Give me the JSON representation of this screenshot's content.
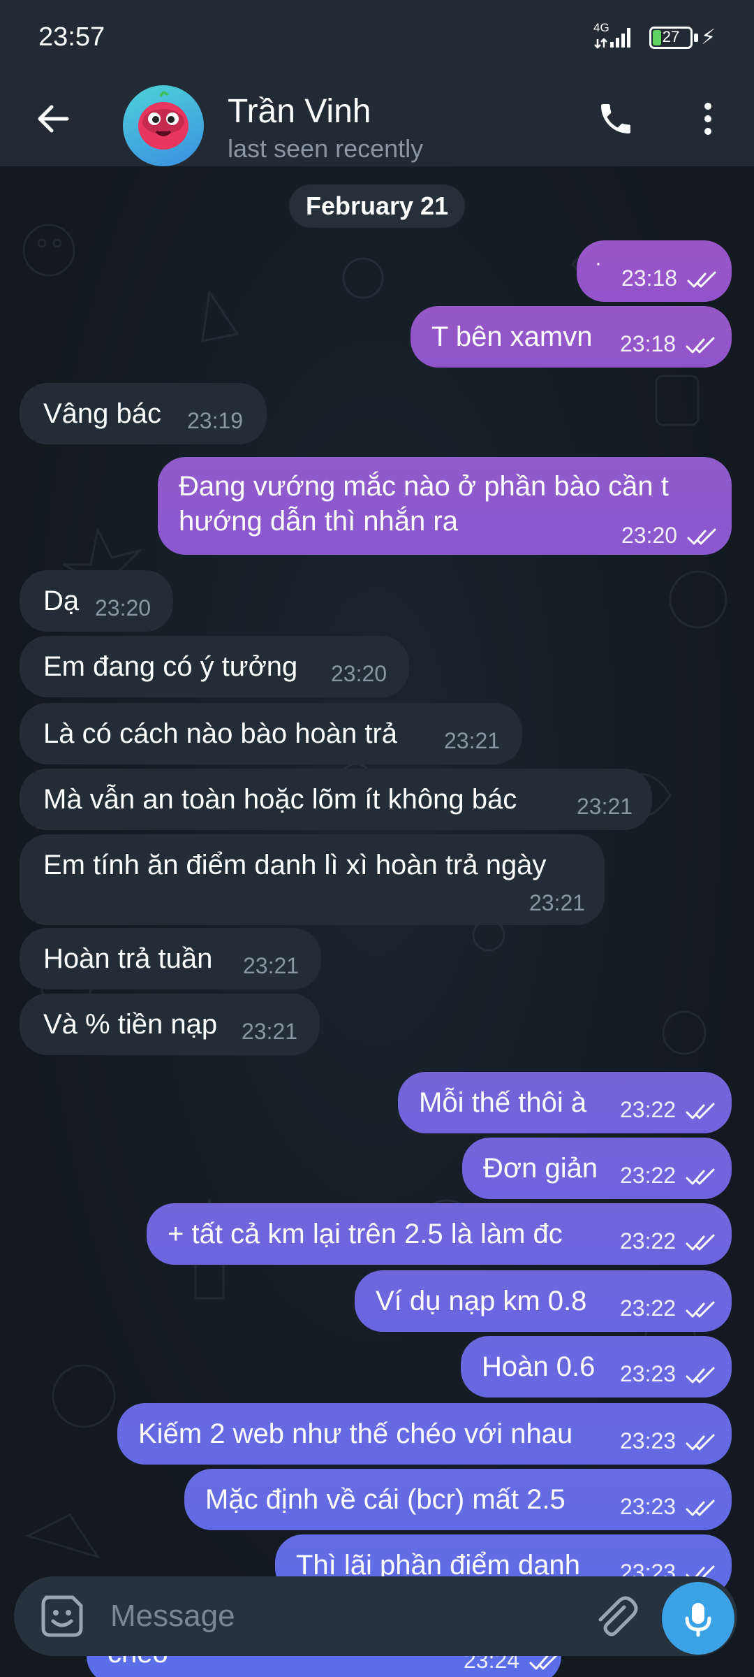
{
  "status_bar": {
    "time": "23:57",
    "network": "4G",
    "battery": "27",
    "battery_level": 0.27
  },
  "header": {
    "contact_name": "Trần Vinh",
    "contact_status": "last seen recently",
    "back_icon": "arrow-left-icon",
    "call_icon": "phone-icon",
    "menu_icon": "more-vertical-icon"
  },
  "chat": {
    "date": "February 21",
    "messages": [
      {
        "dir": "out",
        "text": "·",
        "time": "23:18"
      },
      {
        "dir": "out",
        "text": "T bên xamvn",
        "time": "23:18"
      },
      {
        "dir": "in",
        "text": "Vâng bác",
        "time": "23:19"
      },
      {
        "dir": "out",
        "text": "Đang vướng mắc nào ở phần bào cần t",
        "text2": "hướng dẫn thì nhắn ra",
        "time": "23:20"
      },
      {
        "dir": "in",
        "text": "Dạ",
        "time": "23:20"
      },
      {
        "dir": "in",
        "text": "Em đang có ý tưởng",
        "time": "23:20"
      },
      {
        "dir": "in",
        "text": "Là có cách nào bào hoàn trả",
        "time": "23:21"
      },
      {
        "dir": "in",
        "text": "Mà vẫn an toàn hoặc lõm ít không bác",
        "time": "23:21"
      },
      {
        "dir": "in",
        "text": "Em tính ăn điểm danh lì xì hoàn trả ngày",
        "time": "23:21"
      },
      {
        "dir": "in",
        "text": "Hoàn trả tuần",
        "time": "23:21"
      },
      {
        "dir": "in",
        "text": "Và % tiền nạp",
        "time": "23:21"
      },
      {
        "dir": "out",
        "text": "Mỗi thế thôi à",
        "time": "23:22"
      },
      {
        "dir": "out",
        "text": "Đơn giản",
        "time": "23:22"
      },
      {
        "dir": "out",
        "text": "+ tất cả km lại trên 2.5 là làm đc",
        "time": "23:22"
      },
      {
        "dir": "out",
        "text": "Ví dụ nạp km 0.8",
        "time": "23:22"
      },
      {
        "dir": "out",
        "text": "Hoàn 0.6",
        "time": "23:23"
      },
      {
        "dir": "out",
        "text": "Kiếm 2 web như thế chéo với nhau",
        "time": "23:23"
      },
      {
        "dir": "out",
        "text": "Mặc định về cái (bcr) mất 2.5",
        "time": "23:23"
      },
      {
        "dir": "out",
        "text": "Thì lãi phần điểm danh",
        "time": "23:23"
      },
      {
        "dir": "out",
        "text": "chéo",
        "time": "23:24"
      }
    ]
  },
  "input": {
    "placeholder": "Message",
    "emoji_icon": "sticker-smile-icon",
    "attach_icon": "paperclip-icon",
    "mic_icon": "microphone-icon"
  },
  "colors": {
    "header_bg": "#222b35",
    "incoming_bubble": "#222d38",
    "outgoing_gradient_top": "#9c56c4",
    "outgoing_gradient_bottom": "#5d6fe6",
    "accent": "#3ba2e6"
  }
}
